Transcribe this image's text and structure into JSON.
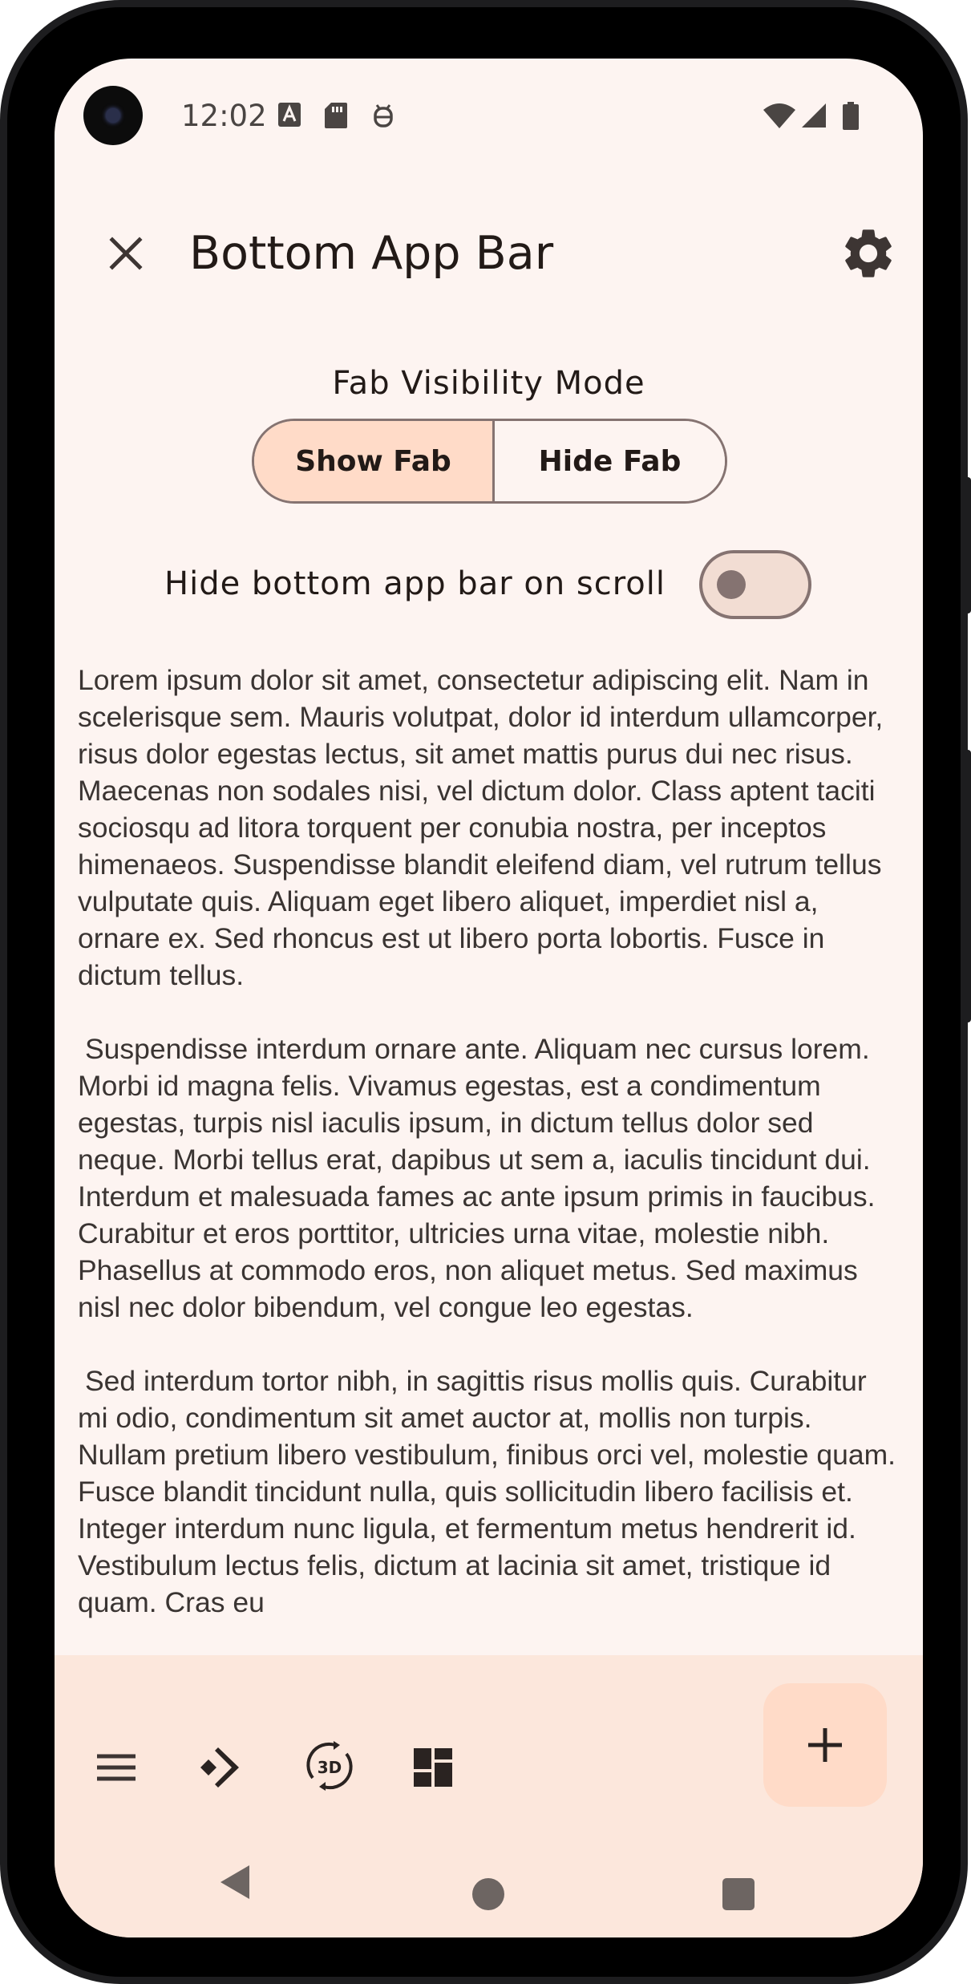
{
  "status_bar": {
    "time": "12:02"
  },
  "top_bar": {
    "title": "Bottom App Bar",
    "close_icon": "close-icon",
    "settings_icon": "gear-icon"
  },
  "fab_visibility": {
    "label": "Fab Visibility Mode",
    "options": [
      "Show Fab",
      "Hide Fab"
    ],
    "selected": "Show Fab"
  },
  "hide_on_scroll": {
    "label": "Hide bottom app bar on scroll",
    "enabled": false
  },
  "body": {
    "paragraphs": [
      "Lorem ipsum dolor sit amet, consectetur adipiscing elit. Nam in scelerisque sem. Mauris volutpat, dolor id interdum ullamcorper, risus dolor egestas lectus, sit amet mattis purus dui nec risus. Maecenas non sodales nisi, vel dictum dolor. Class aptent taciti sociosqu ad litora torquent per conubia nostra, per inceptos himenaeos. Suspendisse blandit eleifend diam, vel rutrum tellus vulputate quis. Aliquam eget libero aliquet, imperdiet nisl a, ornare ex. Sed rhoncus est ut libero porta lobortis. Fusce in dictum tellus.",
      "Suspendisse interdum ornare ante. Aliquam nec cursus lorem. Morbi id magna felis. Vivamus egestas, est a condimentum egestas, turpis nisl iaculis ipsum, in dictum tellus dolor sed neque. Morbi tellus erat, dapibus ut sem a, iaculis tincidunt dui. Interdum et malesuada fames ac ante ipsum primis in faucibus. Curabitur et eros porttitor, ultricies urna vitae, molestie nibh. Phasellus at commodo eros, non aliquet metus. Sed maximus nisl nec dolor bibendum, vel congue leo egestas.",
      "Sed interdum tortor nibh, in sagittis risus mollis quis. Curabitur mi odio, condimentum sit amet auctor at, mollis non turpis. Nullam pretium libero vestibulum, finibus orci vel, molestie quam. Fusce blandit tincidunt nulla, quis sollicitudin libero facilisis et. Integer interdum nunc ligula, et fermentum metus hendrerit id. Vestibulum lectus felis, dictum at lacinia sit amet, tristique id quam. Cras eu"
    ]
  },
  "bottom_app_bar": {
    "actions": [
      "menu-icon",
      "directions-icon",
      "3d-rotation-icon",
      "dashboard-icon"
    ],
    "rotation_icon_text": "3D",
    "fab_icon": "add-icon"
  },
  "colors": {
    "background": "#fdf4f1",
    "bottom_bar": "#fce7dc",
    "selected_segment": "#ffdbc8",
    "outline": "#857371",
    "text": "#221a17"
  }
}
